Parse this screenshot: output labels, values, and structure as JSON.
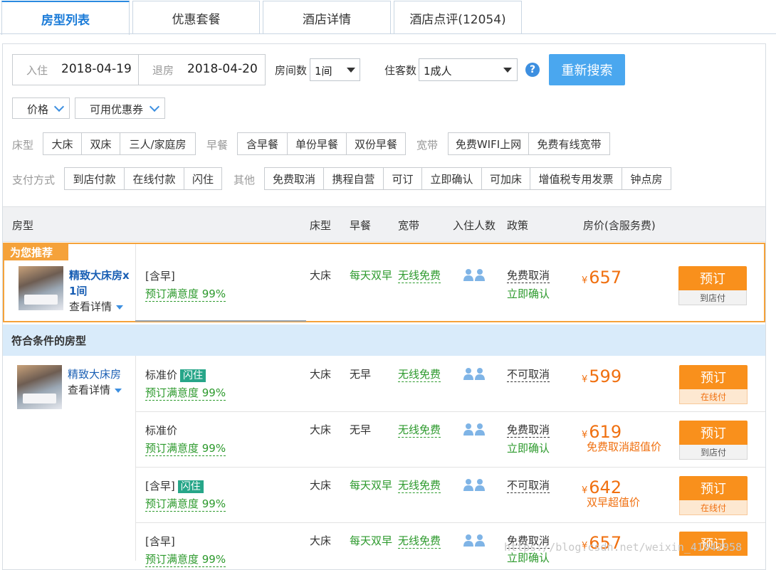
{
  "tabs": [
    {
      "label": "房型列表"
    },
    {
      "label": "优惠套餐"
    },
    {
      "label": "酒店详情"
    },
    {
      "label": "酒店点评(12054)"
    }
  ],
  "search": {
    "checkin_label": "入住",
    "checkin_value": "2018-04-19",
    "checkout_label": "退房",
    "checkout_value": "2018-04-20",
    "rooms_label": "房间数",
    "rooms_value": "1间",
    "guests_label": "住客数",
    "guests_value": "1成人",
    "help": "?",
    "search_button": "重新搜索"
  },
  "sorters": {
    "price": "价格",
    "coupon": "可用优惠券"
  },
  "filters": {
    "bed_label": "床型",
    "bed": [
      "大床",
      "双床",
      "三人/家庭房"
    ],
    "breakfast_label": "早餐",
    "breakfast": [
      "含早餐",
      "单份早餐",
      "双份早餐"
    ],
    "broadband_label": "宽带",
    "broadband": [
      "免费WIFI上网",
      "免费有线宽带"
    ],
    "payment_label": "支付方式",
    "payment": [
      "到店付款",
      "在线付款",
      "闪住"
    ],
    "other_label": "其他",
    "other": [
      "免费取消",
      "携程自营",
      "可订",
      "立即确认",
      "可加床",
      "增值税专用发票",
      "钟点房"
    ]
  },
  "table_header": {
    "room": "房型",
    "bed": "床型",
    "breakfast": "早餐",
    "broadband": "宽带",
    "guests": "入住人数",
    "policy": "政策",
    "price": "房价(含服务费)"
  },
  "recommend": {
    "badge": "为您推荐",
    "room_name_line1": "精致大床房x",
    "room_name_line2": "1间",
    "detail": "查看详情",
    "plan": "[含早]",
    "satisfaction": "预订满意度 99%",
    "bed": "大床",
    "breakfast": "每天双早",
    "broadband": "无线免费",
    "cancel": "免费取消",
    "confirm": "立即确认",
    "yen": "¥",
    "price": "657",
    "book": "预订",
    "pay": "到店付"
  },
  "section_title": "符合条件的房型",
  "room": {
    "name": "精致大床房",
    "detail": "查看详情"
  },
  "rates": [
    {
      "plan": "标准价",
      "flash": "闪住",
      "satisfaction": "预订满意度 99%",
      "bed": "大床",
      "breakfast": "无早",
      "broadband": "无线免费",
      "cancel": "不可取消",
      "confirm": "",
      "yen": "¥",
      "price": "599",
      "promo": "",
      "book": "预订",
      "pay": "在线付"
    },
    {
      "plan": "标准价",
      "flash": "",
      "satisfaction": "预订满意度 99%",
      "bed": "大床",
      "breakfast": "无早",
      "broadband": "无线免费",
      "cancel": "免费取消",
      "confirm": "立即确认",
      "yen": "¥",
      "price": "619",
      "promo": "免费取消超值价",
      "book": "预订",
      "pay": "到店付"
    },
    {
      "plan": "[含早]",
      "flash": "闪住",
      "satisfaction": "预订满意度 99%",
      "bed": "大床",
      "breakfast": "每天双早",
      "broadband": "无线免费",
      "cancel": "不可取消",
      "confirm": "",
      "yen": "¥",
      "price": "642",
      "promo": "双早超值价",
      "book": "预订",
      "pay": "在线付"
    },
    {
      "plan": "[含早]",
      "flash": "",
      "satisfaction": "预订满意度 99%",
      "bed": "大床",
      "breakfast": "每天双早",
      "broadband": "无线免费",
      "cancel": "免费取消",
      "confirm": "立即确认",
      "yen": "¥",
      "price": "657",
      "promo": "",
      "book": "预订",
      "pay": ""
    }
  ],
  "watermark": "https://blog.csdn.net/weixin_41942958"
}
